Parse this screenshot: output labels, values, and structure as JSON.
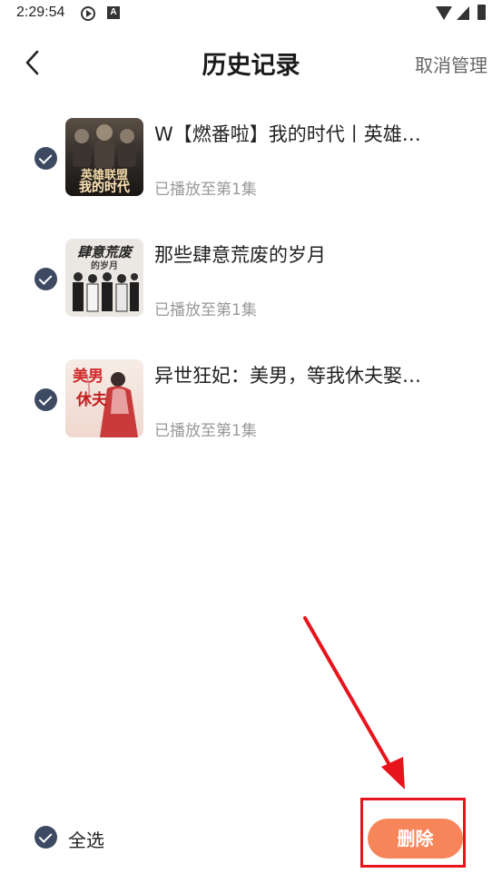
{
  "status_bar": {
    "time": "2:29:54",
    "icons": [
      "play-circle-icon",
      "a-badge-icon",
      "wifi-icon",
      "signal-icon",
      "battery-icon"
    ],
    "a_badge": "A"
  },
  "header": {
    "back_icon": "chevron-left-icon",
    "title": "历史记录",
    "manage_label": "取消管理"
  },
  "history": [
    {
      "title": "W【燃番啦】我的时代丨英雄…",
      "progress": "已播放至第1集",
      "checked": true,
      "cover_lines": [
        "英雄联盟",
        "我的时代"
      ],
      "cover_color": "#2e2a27"
    },
    {
      "title": "那些肆意荒废的岁月",
      "progress": "已播放至第1集",
      "checked": true,
      "cover_lines": [
        "肆意荒废",
        "的岁月"
      ],
      "cover_color": "#e8e4df"
    },
    {
      "title": "异世狂妃：美男，等我休夫娶…",
      "progress": "已播放至第1集",
      "checked": true,
      "cover_lines": [
        "美男",
        "休夫"
      ],
      "cover_color": "#f2e3dc"
    }
  ],
  "bottom_bar": {
    "select_all_label": "全选",
    "select_all_checked": true,
    "delete_label": "删除"
  },
  "colors": {
    "accent": "#f7855a",
    "check": "#3d4a62",
    "annotation": "#e8141c",
    "muted_text": "#999999"
  }
}
